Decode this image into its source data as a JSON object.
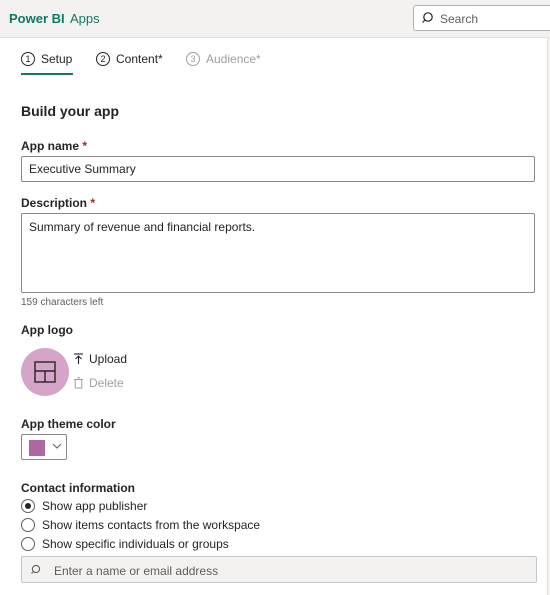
{
  "header": {
    "brand": "Power BI",
    "breadcrumb": "Apps",
    "search_placeholder": "Search"
  },
  "steps": [
    {
      "number": "1",
      "label": "Setup",
      "state": "active"
    },
    {
      "number": "2",
      "label": "Content*",
      "state": "enabled"
    },
    {
      "number": "3",
      "label": "Audience*",
      "state": "disabled"
    }
  ],
  "form": {
    "heading": "Build your app",
    "app_name": {
      "label": "App name",
      "required_mark": "*",
      "value": "Executive Summary"
    },
    "description": {
      "label": "Description",
      "required_mark": "*",
      "value": "Summary of revenue and financial reports.",
      "chars_left": "159 characters left"
    },
    "app_logo": {
      "label": "App logo",
      "upload": "Upload",
      "delete": "Delete"
    },
    "theme": {
      "label": "App theme color",
      "color": "#b0679d"
    },
    "contact": {
      "label": "Contact information",
      "options": [
        {
          "label": "Show app publisher",
          "checked": true
        },
        {
          "label": "Show items contacts from the workspace",
          "checked": false
        },
        {
          "label": "Show specific individuals or groups",
          "checked": false
        }
      ],
      "input_placeholder": "Enter a name or email address"
    }
  },
  "colors": {
    "brand": "#117865",
    "required": "#a4262c",
    "logo_bg": "#d6a3c9"
  }
}
